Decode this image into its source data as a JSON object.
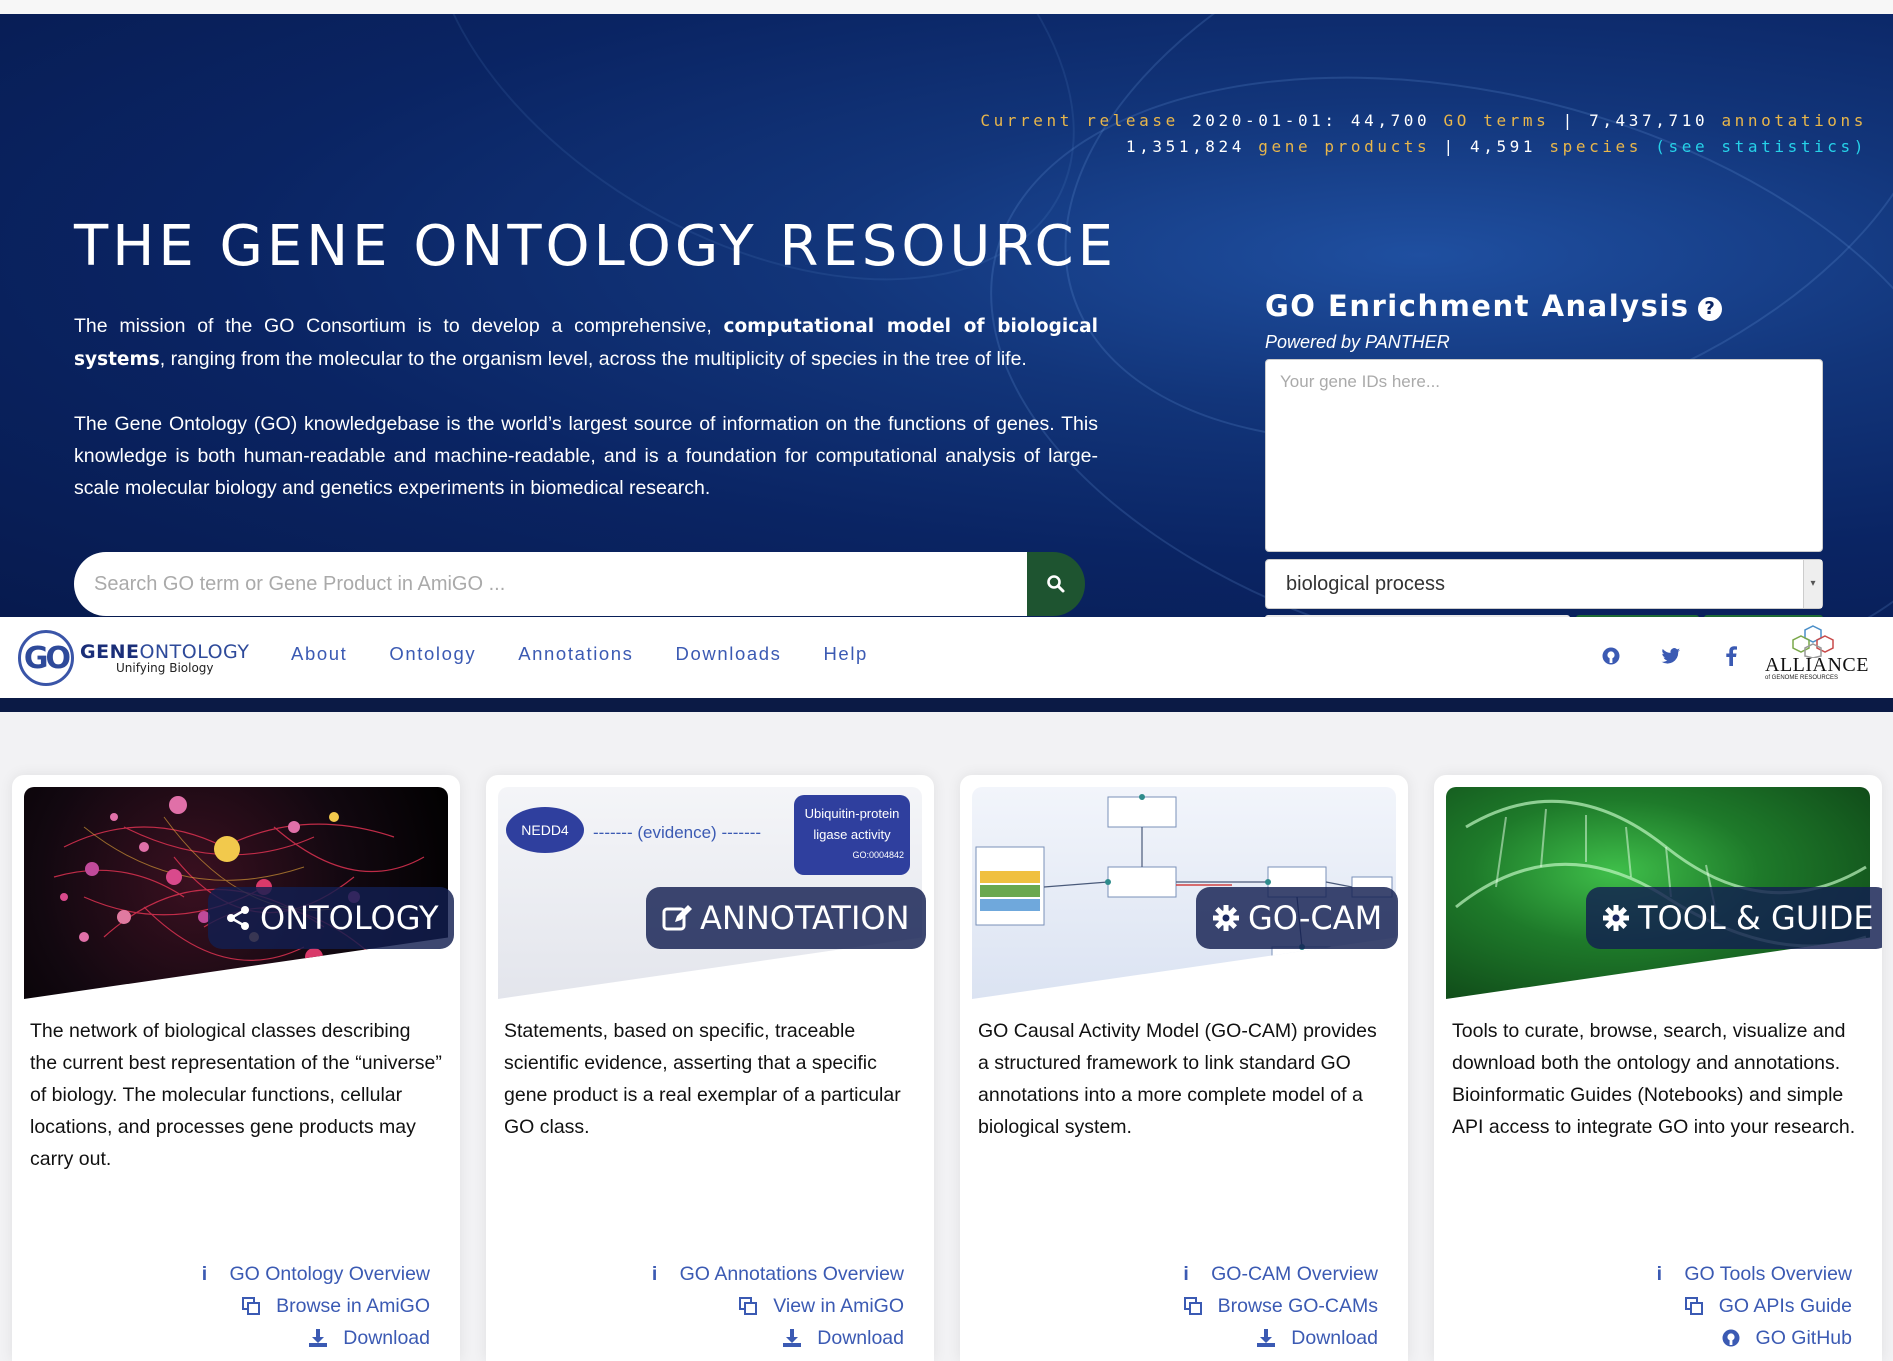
{
  "release": {
    "prefix": "Current release",
    "date": "2020-01-01:",
    "terms_count": "44,700",
    "terms_label": "GO terms",
    "annotations_count": "7,437,710",
    "annotations_label": "annotations",
    "genes_count": "1,351,824",
    "genes_label": "gene products",
    "species_count": "4,591",
    "species_label": "species",
    "stats_link": "(see statistics)",
    "sep": "|"
  },
  "hero": {
    "title": "THE GENE ONTOLOGY RESOURCE",
    "p1_start": "The mission of the GO Consortium is to develop a comprehensive,",
    "p1_bold": "computational model of biological systems",
    "p1_end": ", ranging from the molecular to the organism level, across the multiplicity of species in the tree of life.",
    "p2": "The Gene Ontology (GO) knowledgebase is the world’s largest source of information on the functions of genes. This knowledge is both human-readable and machine-readable, and is a foundation for computational analysis of large-scale molecular biology and genetics experiments in biomedical research.",
    "search_placeholder": "Search GO term or Gene Product in AmiGO ..."
  },
  "enrichment": {
    "title": "GO Enrichment Analysis",
    "help": "?",
    "powered": "Powered by PANTHER",
    "textarea_placeholder": "Your gene IDs here...",
    "selected_ontology": "biological process"
  },
  "navbar": {
    "logo_gene": "GENE",
    "logo_ontology": "ONTOLOGY",
    "logo_tagline": "Unifying Biology",
    "logo_mark": "GO",
    "links": [
      "About",
      "Ontology",
      "Annotations",
      "Downloads",
      "Help"
    ],
    "icons": [
      "github-icon",
      "twitter-icon",
      "facebook-icon"
    ],
    "alliance_word": "ALLIANCE",
    "alliance_sub": "of GENOME RESOURCES"
  },
  "cards": [
    {
      "badge": "ONTOLOGY",
      "badge_icon": "share-icon",
      "description": "The network of biological classes describing the current best representation of the “universe” of biology. The molecular functions, cellular locations, and processes gene products may carry out.",
      "links": [
        {
          "icon": "info-icon",
          "label": "GO Ontology Overview"
        },
        {
          "icon": "copy-icon",
          "label": "Browse in AmiGO"
        },
        {
          "icon": "download-icon",
          "label": "Download"
        }
      ]
    },
    {
      "badge": "ANNOTATION",
      "badge_icon": "edit-icon",
      "description": "Statements, based on specific, traceable scientific evidence, asserting that a specific gene product is a real exemplar of a particular GO class.",
      "image_gene": "NEDD4",
      "image_evidence": "------- (evidence) -------",
      "image_term_line1": "Ubiquitin-protein",
      "image_term_line2": "ligase activity",
      "image_term_id": "GO:0004842",
      "links": [
        {
          "icon": "info-icon",
          "label": "GO Annotations Overview"
        },
        {
          "icon": "copy-icon",
          "label": "View in AmiGO"
        },
        {
          "icon": "download-icon",
          "label": "Download"
        }
      ]
    },
    {
      "badge": "GO-CAM",
      "badge_icon": "gear-icon",
      "description": "GO Causal Activity Model (GO-CAM) provides a structured framework to link standard GO annotations into a more complete model of a biological system.",
      "links": [
        {
          "icon": "info-icon",
          "label": "GO-CAM Overview"
        },
        {
          "icon": "copy-icon",
          "label": "Browse GO-CAMs"
        },
        {
          "icon": "download-icon",
          "label": "Download"
        }
      ]
    },
    {
      "badge": "TOOL & GUIDE",
      "badge_icon": "gear-icon",
      "description": "Tools to curate, browse, search, visualize and download both the ontology and annotations. Bioinformatic Guides (Notebooks) and simple API access to integrate GO into your research.",
      "links": [
        {
          "icon": "info-icon",
          "label": "GO Tools Overview"
        },
        {
          "icon": "copy-icon",
          "label": "GO APIs Guide"
        },
        {
          "icon": "github-icon",
          "label": "GO GitHub"
        }
      ]
    }
  ],
  "colors": {
    "hero_bg": "#0a2463",
    "release_orange": "#e8b64b",
    "release_cyan": "#26d1e8",
    "link_blue": "#3b5ab3",
    "search_button": "#1e5430"
  }
}
